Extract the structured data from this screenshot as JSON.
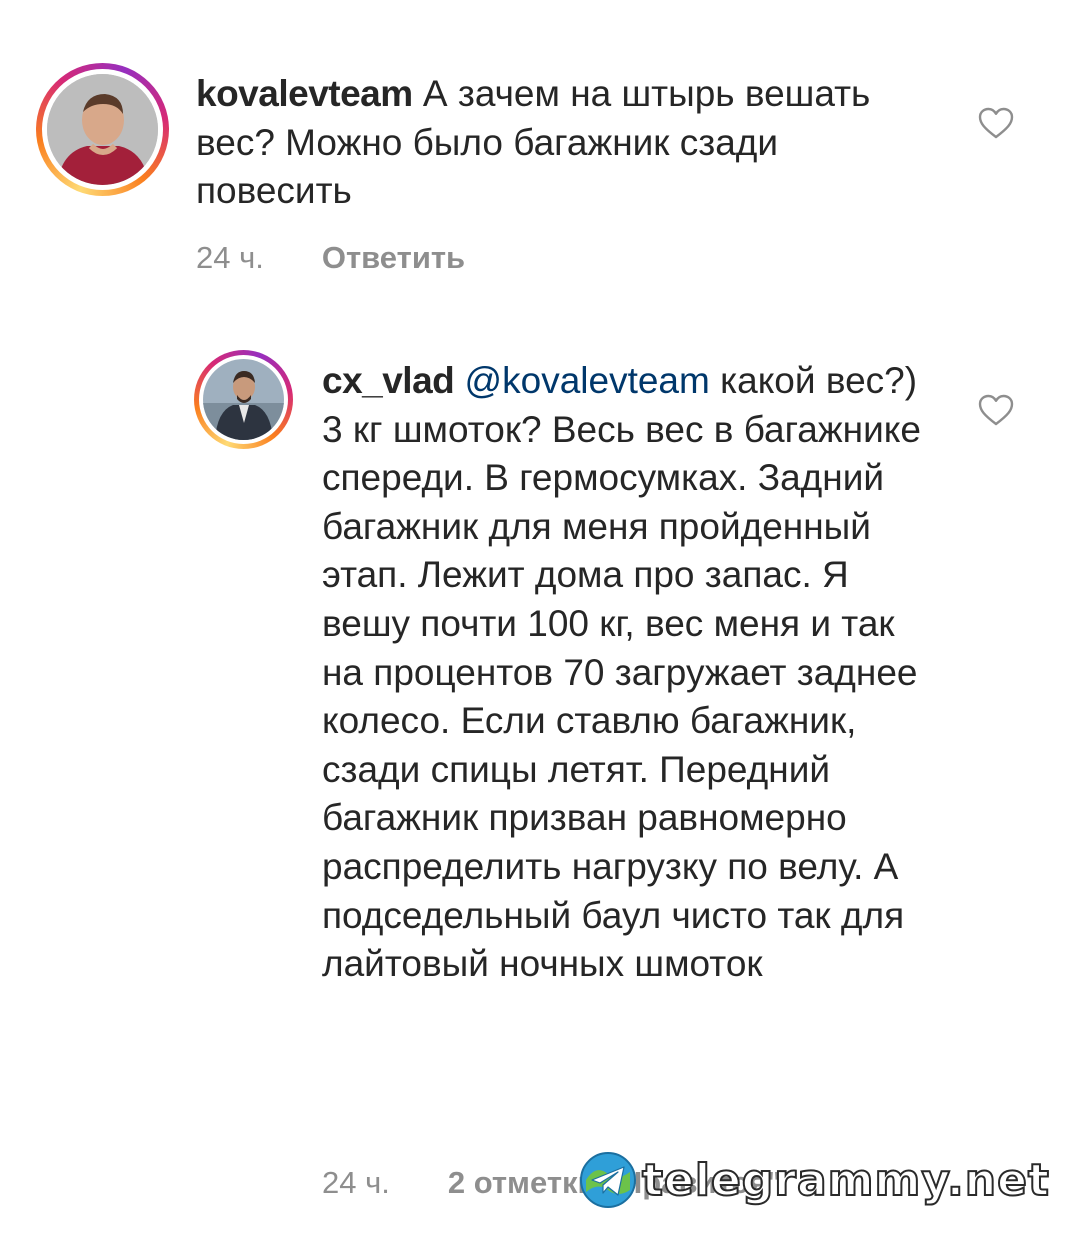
{
  "comments": [
    {
      "username": "kovalevteam",
      "mention": "",
      "text": " А зачем на штырь вешать вес? Можно было багажник сзади повесить",
      "time": "24 ч.",
      "reply_label": "Ответить",
      "avatar_icon": "person-avatar-icon",
      "heart_icon": "heart-outline-icon"
    },
    {
      "username": "cx_vlad",
      "mention": " @kovalevteam",
      "text": " какой вес?) 3 кг шмоток? Весь вес в багажнике спереди. В гермосумках. Задний багажник для меня пройденный этап. Лежит дома про запас. Я вешу почти 100 кг, вес меня и так на процентов 70 загружает заднее колесо. Если ставлю багажник, сзади спицы летят. Передний багажник призван равномерно распределить нагрузку по велу. А подседельный баул чисто так для лайтовый ночных шмоток",
      "time": "24 ч.",
      "reply_label": "2 отметки \"Нравится\"",
      "avatar_icon": "person-avatar-icon",
      "heart_icon": "heart-outline-icon"
    }
  ],
  "watermark": {
    "text": "telegrammy.net",
    "icon": "telegram-globe-icon"
  },
  "colors": {
    "text": "#262626",
    "meta": "#8e8e8e",
    "mention": "#00376b",
    "ring_start": "#feda75",
    "ring_mid": "#d62976",
    "ring_end": "#962fbf"
  }
}
